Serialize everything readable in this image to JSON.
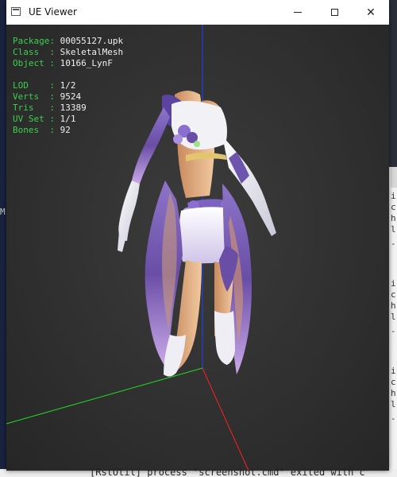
{
  "window": {
    "title": "UE Viewer",
    "minimize_glyph": "—",
    "maximize_glyph": "☐",
    "close_glyph": "✕"
  },
  "info": {
    "package": {
      "label": "Package:",
      "value": "00055127.upk"
    },
    "class": {
      "label": "Class  :",
      "value": "SkeletalMesh"
    },
    "object": {
      "label": "Object :",
      "value": "10166_LynF"
    },
    "lod": {
      "label": "LOD    :",
      "value": "1/2"
    },
    "verts": {
      "label": "Verts  :",
      "value": "9524"
    },
    "tris": {
      "label": "Tris   :",
      "value": "13389"
    },
    "uvset": {
      "label": "UV Set :",
      "value": "1/1"
    },
    "bones": {
      "label": "Bones  :",
      "value": "92"
    }
  },
  "background": {
    "left_char": "M",
    "right_chars": [
      "i",
      "c",
      "h",
      "l",
      "-",
      "i",
      "c",
      "h",
      "l",
      "-",
      "i",
      "c",
      "h",
      "l",
      "-"
    ],
    "console_line": "[RstUtil] process \"screenshot.cmd\" exited with c"
  },
  "colors": {
    "info_label": "#38d24a",
    "axis_x": "#ff2020",
    "axis_y": "#20e020",
    "axis_z": "#2040ff",
    "viewport_bg": "#303030"
  }
}
